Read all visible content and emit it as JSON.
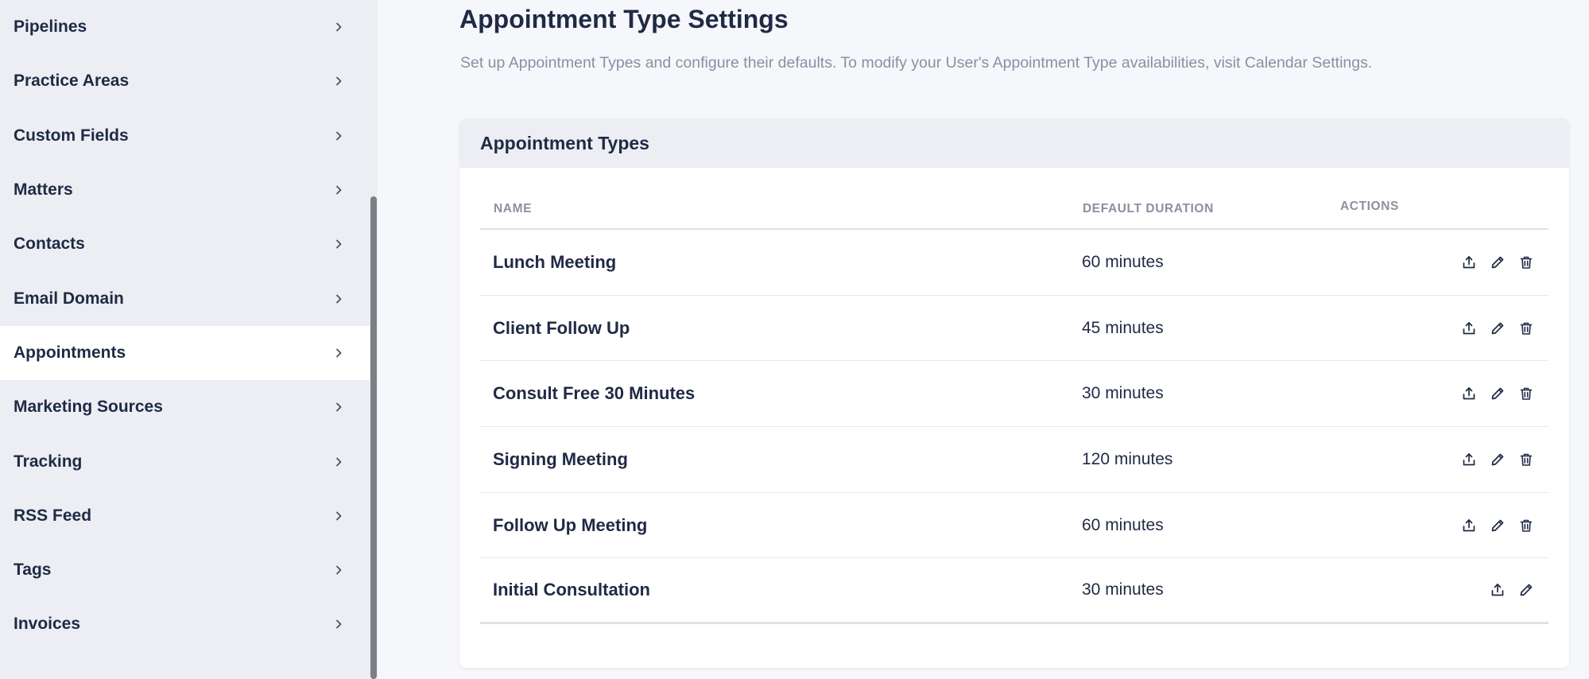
{
  "sidebar": {
    "items": [
      {
        "label": "Pipelines"
      },
      {
        "label": "Practice Areas"
      },
      {
        "label": "Custom Fields"
      },
      {
        "label": "Matters"
      },
      {
        "label": "Contacts"
      },
      {
        "label": "Email Domain"
      },
      {
        "label": "Appointments",
        "active": true
      },
      {
        "label": "Marketing Sources"
      },
      {
        "label": "Tracking"
      },
      {
        "label": "RSS Feed"
      },
      {
        "label": "Tags"
      },
      {
        "label": "Invoices"
      }
    ]
  },
  "page": {
    "title": "Appointment Type Settings",
    "subtitle": "Set up Appointment Types and configure their defaults.  To modify your User's Appointment Type availabilities, visit Calendar Settings."
  },
  "card": {
    "title": "Appointment Types",
    "columns": {
      "name": "Name",
      "duration": "Default Duration",
      "actions": "Actions"
    },
    "rows": [
      {
        "name": "Lunch Meeting",
        "duration": "60 minutes",
        "actions": [
          "upload-icon",
          "edit-icon",
          "trash-icon"
        ]
      },
      {
        "name": "Client Follow Up",
        "duration": "45 minutes",
        "actions": [
          "upload-icon",
          "edit-icon",
          "trash-icon"
        ]
      },
      {
        "name": "Consult Free 30 Minutes",
        "duration": "30 minutes",
        "actions": [
          "upload-icon",
          "edit-icon",
          "trash-icon"
        ]
      },
      {
        "name": "Signing Meeting",
        "duration": "120 minutes",
        "actions": [
          "upload-icon",
          "edit-icon",
          "trash-icon"
        ]
      },
      {
        "name": "Follow Up Meeting",
        "duration": "60 minutes",
        "actions": [
          "upload-icon",
          "edit-icon",
          "trash-icon"
        ]
      },
      {
        "name": "Initial Consultation",
        "duration": "30 minutes",
        "actions": [
          "upload-icon",
          "edit-icon"
        ]
      }
    ]
  },
  "colors": {
    "sidebar_bg": "#eceef3",
    "active_bg": "#ffffff",
    "text_primary": "#1f2a44",
    "text_muted": "#8a90a0",
    "page_bg": "#f6f7fb"
  }
}
